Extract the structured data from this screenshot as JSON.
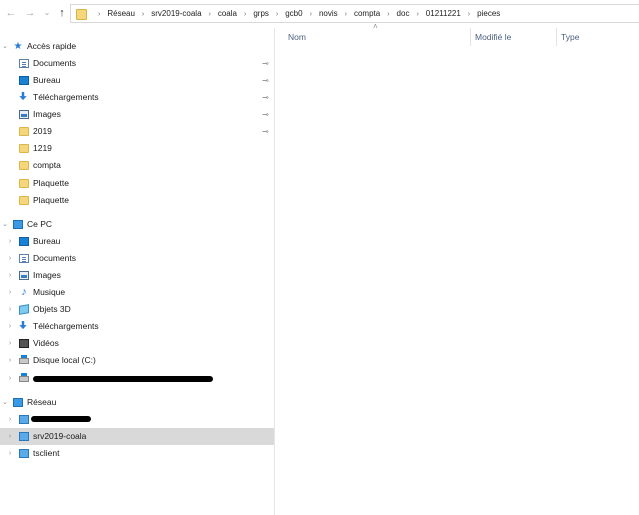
{
  "nav_buttons": {
    "back": "←",
    "forward": "→",
    "recent": "⌄",
    "up": "↑"
  },
  "breadcrumbs": [
    "Réseau",
    "srv2019-coala",
    "coala",
    "grps",
    "gcb0",
    "novis",
    "compta",
    "doc",
    "01211221",
    "pieces"
  ],
  "breadcrumb_separator": "›",
  "quick_access": {
    "header": "Accès rapide",
    "items": [
      {
        "label": "Documents",
        "icon": "documents-icon",
        "pinned": true
      },
      {
        "label": "Bureau",
        "icon": "desktop-icon",
        "pinned": true
      },
      {
        "label": "Téléchargements",
        "icon": "download-icon",
        "pinned": true
      },
      {
        "label": "Images",
        "icon": "images-icon",
        "pinned": true
      },
      {
        "label": "2019",
        "icon": "folder-icon",
        "pinned": true
      },
      {
        "label": "1219",
        "icon": "folder-icon",
        "pinned": false
      },
      {
        "label": "compta",
        "icon": "folder-icon",
        "pinned": false
      },
      {
        "label": "Plaquette",
        "icon": "folder-icon",
        "pinned": false
      },
      {
        "label": "Plaquette",
        "icon": "folder-icon",
        "pinned": false
      }
    ]
  },
  "this_pc": {
    "header": "Ce PC",
    "items": [
      {
        "label": "Bureau",
        "icon": "desktop-icon"
      },
      {
        "label": "Documents",
        "icon": "documents-icon"
      },
      {
        "label": "Images",
        "icon": "images-icon"
      },
      {
        "label": "Musique",
        "icon": "music-icon"
      },
      {
        "label": "Objets 3D",
        "icon": "objects-3d-icon"
      },
      {
        "label": "Téléchargements",
        "icon": "download-icon"
      },
      {
        "label": "Vidéos",
        "icon": "videos-icon"
      },
      {
        "label": "Disque local (C:)",
        "icon": "drive-icon"
      },
      {
        "label": "",
        "icon": "network-drive-icon",
        "redacted": true
      }
    ]
  },
  "network": {
    "header": "Réseau",
    "items": [
      {
        "label": "",
        "icon": "computer-icon",
        "redacted": true
      },
      {
        "label": "srv2019-coala",
        "icon": "computer-icon",
        "selected": true
      },
      {
        "label": "tsclient",
        "icon": "computer-icon"
      }
    ]
  },
  "columns": {
    "name": "Nom",
    "modified": "Modifié le",
    "type": "Type"
  },
  "sort_indicator": "˄",
  "chevron_expanded": "⌄",
  "chevron_collapsed": "›",
  "pin_glyph": "📌"
}
